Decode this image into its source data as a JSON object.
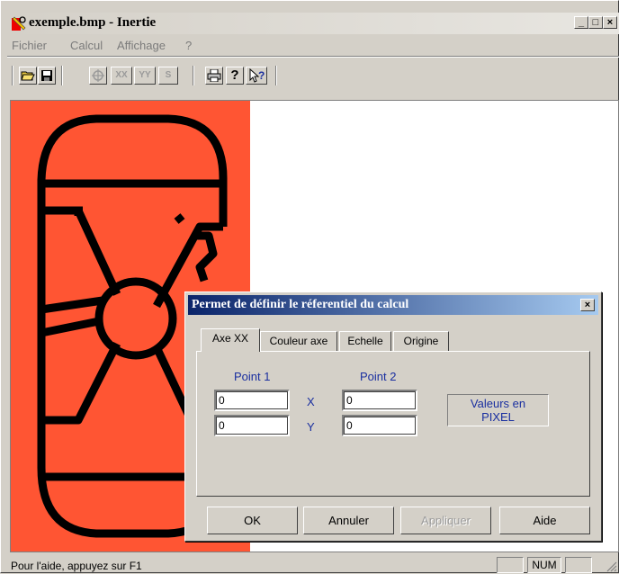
{
  "window": {
    "title": "exemple.bmp - Inertie",
    "controls": {
      "minimize": "_",
      "maximize": "□",
      "close": "×"
    }
  },
  "menu": {
    "items": [
      "Fichier",
      "Calcul",
      "Affichage",
      "?"
    ]
  },
  "toolbar": {
    "buttons": [
      {
        "icon": "open-folder-icon",
        "label": ""
      },
      {
        "icon": "save-disk-icon",
        "label": ""
      },
      {
        "icon": "target-icon",
        "label": ""
      },
      {
        "icon": "xx-axis-icon",
        "label": "XX"
      },
      {
        "icon": "yy-axis-icon",
        "label": "YY"
      },
      {
        "icon": "s-icon",
        "label": "S"
      },
      {
        "icon": "printer-icon",
        "label": ""
      },
      {
        "icon": "help-icon",
        "label": "?"
      },
      {
        "icon": "context-help-icon",
        "label": "?"
      }
    ]
  },
  "canvas": {
    "image_background": "#ff5533"
  },
  "dialog": {
    "title": "Permet de définir le réferentiel du calcul",
    "close": "×",
    "tabs": [
      "Axe XX",
      "Couleur axe",
      "Echelle",
      "Origine"
    ],
    "point1_label": "Point 1",
    "point2_label": "Point 2",
    "x_label": "X",
    "y_label": "Y",
    "p1x": "0",
    "p1y": "0",
    "p2x": "0",
    "p2y": "0",
    "units_line1": "Valeurs en",
    "units_line2": "PIXEL",
    "buttons": {
      "ok": "OK",
      "cancel": "Annuler",
      "apply": "Appliquer",
      "help": "Aide"
    }
  },
  "status": {
    "text": "Pour l'aide, appuyez sur F1",
    "num": "NUM"
  },
  "colors": {
    "accent_blue": "#1a2fa0",
    "titlebar_active": "#0a246a"
  }
}
